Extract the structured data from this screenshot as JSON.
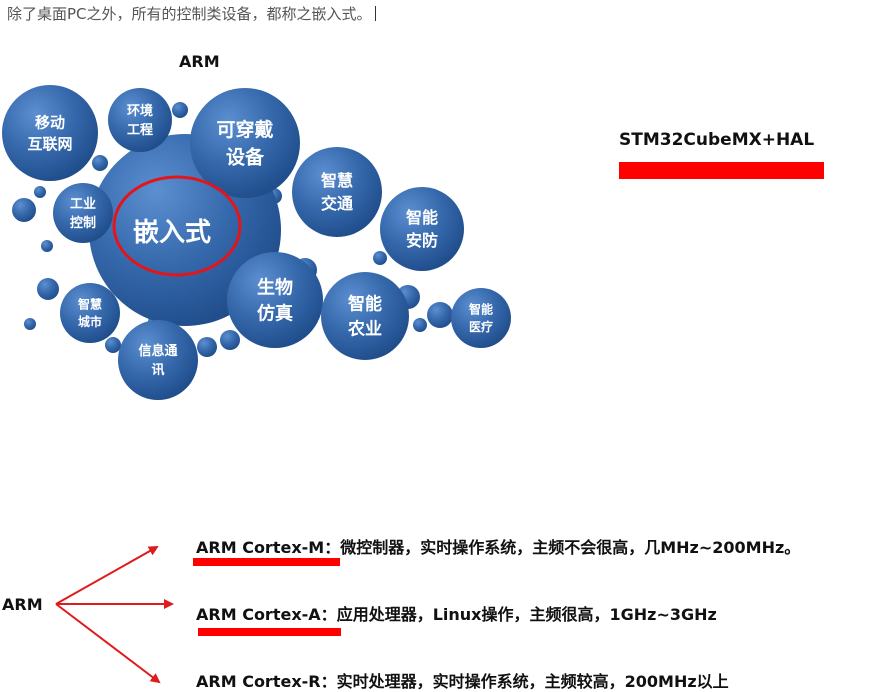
{
  "intro": "除了桌面PC之外，所有的控制类设备，都称之嵌入式。",
  "bubble_chart": {
    "title": "ARM",
    "center": "嵌入式",
    "bubbles": [
      {
        "id": "mobile",
        "lines": [
          "移动",
          "互联网"
        ]
      },
      {
        "id": "env",
        "lines": [
          "环境",
          "工程"
        ]
      },
      {
        "id": "wearable",
        "lines": [
          "可穿戴",
          "设备"
        ]
      },
      {
        "id": "traffic",
        "lines": [
          "智慧",
          "交通"
        ]
      },
      {
        "id": "security",
        "lines": [
          "智能",
          "安防"
        ]
      },
      {
        "id": "industrial",
        "lines": [
          "工业",
          "控制"
        ]
      },
      {
        "id": "city",
        "lines": [
          "智慧",
          "城市"
        ]
      },
      {
        "id": "bio",
        "lines": [
          "生物",
          "仿真"
        ]
      },
      {
        "id": "agri",
        "lines": [
          "智能",
          "农业"
        ]
      },
      {
        "id": "medical",
        "lines": [
          "智能",
          "医疗"
        ]
      },
      {
        "id": "comm",
        "lines": [
          "信息通",
          "讯"
        ]
      }
    ],
    "colors": {
      "bubble": "#2e63a3",
      "bubble_highlight": "#5b8fd0",
      "circle_mark": "#e3151a"
    }
  },
  "stm_label": "STM32CubeMX+HAL",
  "arm_root": "ARM",
  "cores": [
    {
      "name": "ARM Cortex-M",
      "sep": "：",
      "desc": "微控制器，实时操作系统，主频不会很高，几MHz~200MHz。"
    },
    {
      "name": "ARM Cortex-A",
      "sep": "：",
      "desc": "应用处理器，Linux操作，主频很高，1GHz~3GHz"
    },
    {
      "name": "ARM Cortex-R",
      "sep": "：",
      "desc": "实时处理器，实时操作系统，主频较高，200MHz以上"
    }
  ],
  "accent_color": "#ff0000"
}
